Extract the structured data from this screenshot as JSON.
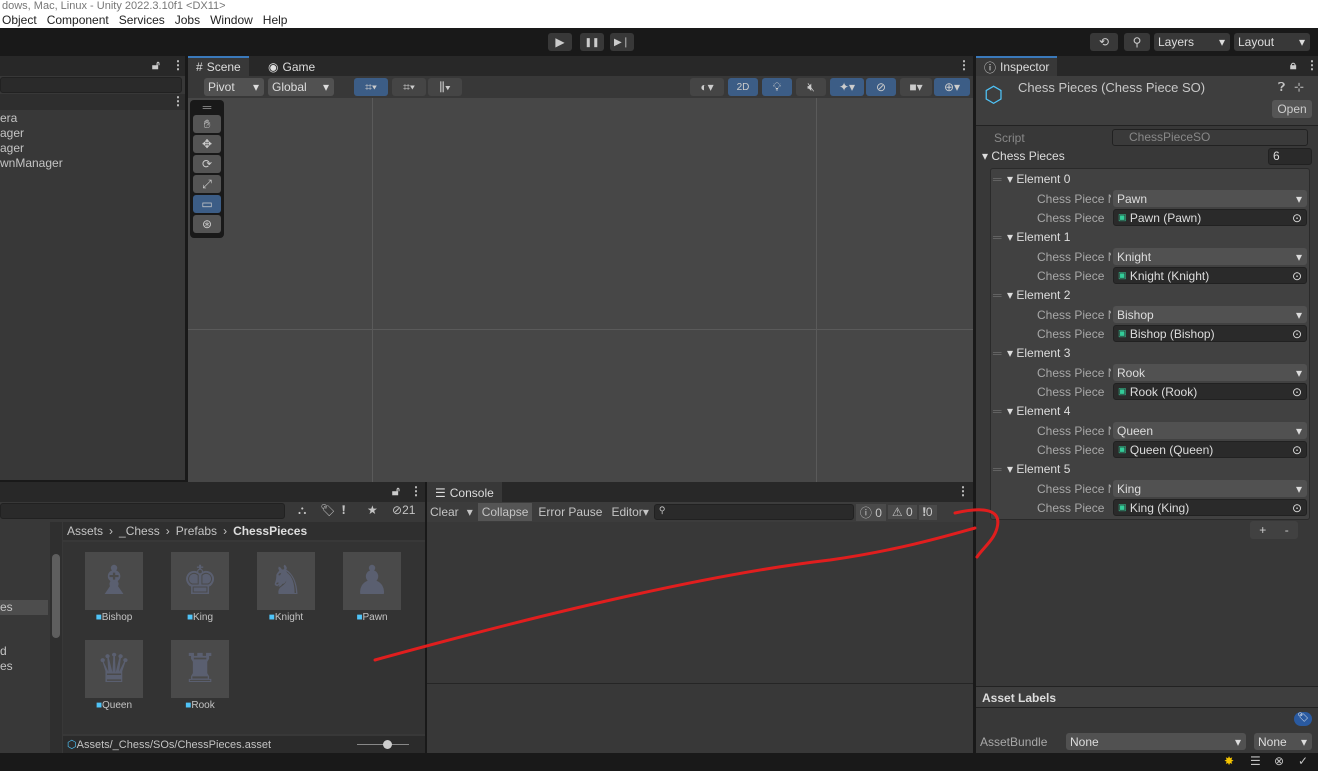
{
  "window": {
    "title": "dows, Mac, Linux - Unity 2022.3.10f1 <DX11>"
  },
  "menu": [
    "Object",
    "Component",
    "Services",
    "Jobs",
    "Window",
    "Help"
  ],
  "toolbar": {
    "play": "▶",
    "pause": "❚❚",
    "step": "▶❘",
    "layers": "Layers",
    "layout": "Layout"
  },
  "hierarchy": {
    "items": [
      "era",
      "ager",
      "ager",
      "wnManager"
    ]
  },
  "scene": {
    "tabs": [
      "Scene",
      "Game"
    ],
    "pivot": "Pivot",
    "global": "Global",
    "mode_2d": "2D"
  },
  "inspector": {
    "tab": "Inspector",
    "title": "Chess Pieces (Chess Piece SO)",
    "open": "Open",
    "script_label": "Script",
    "script_value": "ChessPieceSO",
    "list_label": "Chess Pieces",
    "list_size": "6",
    "elements": [
      {
        "name": "Element 0",
        "type_label": "Chess Piece N",
        "type": "Pawn",
        "obj_label": "Chess Piece",
        "obj": "Pawn (Pawn)"
      },
      {
        "name": "Element 1",
        "type_label": "Chess Piece N",
        "type": "Knight",
        "obj_label": "Chess Piece",
        "obj": "Knight (Knight)"
      },
      {
        "name": "Element 2",
        "type_label": "Chess Piece N",
        "type": "Bishop",
        "obj_label": "Chess Piece",
        "obj": "Bishop  (Bishop)"
      },
      {
        "name": "Element 3",
        "type_label": "Chess Piece N",
        "type": "Rook",
        "obj_label": "Chess Piece",
        "obj": "Rook (Rook)"
      },
      {
        "name": "Element 4",
        "type_label": "Chess Piece N",
        "type": "Queen",
        "obj_label": "Chess Piece",
        "obj": "Queen (Queen)"
      },
      {
        "name": "Element 5",
        "type_label": "Chess Piece N",
        "type": "King",
        "obj_label": "Chess Piece",
        "obj": "King (King)"
      }
    ],
    "add": "+",
    "remove": "-",
    "asset_labels": "Asset Labels",
    "asset_bundle_label": "AssetBundle",
    "asset_bundle": "None",
    "variant": "None"
  },
  "project": {
    "hidden_count": "21",
    "breadcrumb": [
      "Assets",
      "_Chess",
      "Prefabs",
      "ChessPieces"
    ],
    "assets": [
      {
        "name": "Bishop",
        "glyph": "♝"
      },
      {
        "name": "King",
        "glyph": "♚"
      },
      {
        "name": "Knight",
        "glyph": "♞"
      },
      {
        "name": "Pawn",
        "glyph": "♟"
      },
      {
        "name": "Queen",
        "glyph": "♛"
      },
      {
        "name": "Rook",
        "glyph": "♜"
      }
    ],
    "path": "Assets/_Chess/SOs/ChessPieces.asset",
    "sidebar": [
      "es",
      "d",
      "es"
    ]
  },
  "console": {
    "tab": "Console",
    "clear": "Clear",
    "collapse": "Collapse",
    "error_pause": "Error Pause",
    "editor": "Editor",
    "info_count": "0",
    "warn_count": "0",
    "error_count": "0"
  },
  "colors": {
    "accent": "#3c5d86",
    "annotation": "#e01e1e"
  }
}
